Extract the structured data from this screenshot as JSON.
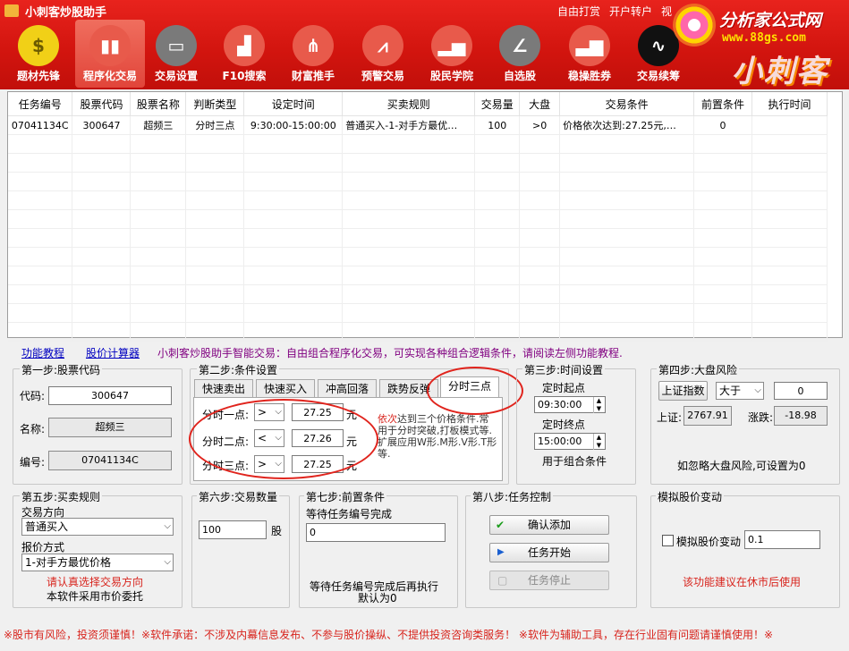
{
  "window": {
    "title": "小刺客炒股助手"
  },
  "toplinks": [
    "自由打赏",
    "开户转户",
    "视"
  ],
  "brand": {
    "logo_text": "分析家公式网",
    "url": "www.88gs.com",
    "watermark": "小刺客"
  },
  "nav": [
    {
      "label": "题材先锋",
      "icon": "coin-icon",
      "color": "#f1d017"
    },
    {
      "label": "程序化交易",
      "icon": "bar-chart-icon",
      "color": "#e85a4b"
    },
    {
      "label": "交易设置",
      "icon": "monitor-chart-icon",
      "color": "#7a7a7a"
    },
    {
      "label": "F10搜索",
      "icon": "growth-chart-icon",
      "color": "#e85a4b"
    },
    {
      "label": "财富推手",
      "icon": "network-icon",
      "color": "#e85a4b"
    },
    {
      "label": "预警交易",
      "icon": "trend-chart-icon",
      "color": "#e85a4b"
    },
    {
      "label": "股民学院",
      "icon": "bars-flag-icon",
      "color": "#e85a4b"
    },
    {
      "label": "自选股",
      "icon": "line-chart-icon",
      "color": "#7a7a7a"
    },
    {
      "label": "稳操胜券",
      "icon": "rising-bars-icon",
      "color": "#e85a4b"
    },
    {
      "label": "交易续筹",
      "icon": "wave-chart-icon",
      "color": "#111111"
    }
  ],
  "table": {
    "columns": [
      "任务编号",
      "股票代码",
      "股票名称",
      "判断类型",
      "设定时间",
      "买卖规则",
      "交易量",
      "大盘",
      "交易条件",
      "前置条件",
      "执行时间"
    ],
    "rows": [
      [
        "07041134C",
        "300647",
        "超频三",
        "分时三点",
        "9:30:00-15:00:00",
        "普通买入-1-对手方最优…",
        "100",
        ">0",
        "价格依次达到:27.25元,…",
        "0",
        ""
      ]
    ]
  },
  "infobar": {
    "tutorial_link": "功能教程",
    "calc_link": "股价计算器",
    "intro": "小刺客炒股助手智能交易：自由组合程序化交易，可实现各种组合逻辑条件，请阅读左侧功能教程."
  },
  "step1": {
    "title": "第一步:股票代码",
    "code_label": "代码:",
    "code": "300647",
    "name_label": "名称:",
    "name": "超频三",
    "id_label": "编号:",
    "id": "07041134C"
  },
  "step2": {
    "title": "第二步:条件设置",
    "tabs": [
      "快速卖出",
      "快速买入",
      "冲高回落",
      "跌势反弹",
      "分时三点"
    ],
    "points": [
      {
        "label": "分时一点:",
        "op": ">",
        "value": "27.25",
        "unit": "元"
      },
      {
        "label": "分时二点:",
        "op": "<",
        "value": "27.26",
        "unit": "元"
      },
      {
        "label": "分时三点:",
        "op": ">",
        "value": "27.25",
        "unit": "元"
      }
    ],
    "hint_prefix": "依次",
    "hint": "达到三个价格条件.常用于分时突破,打板模式等.扩展应用W形.M形.V形.T形等."
  },
  "step3": {
    "title": "第三步:时间设置",
    "start_label": "定时起点",
    "start": "09:30:00",
    "end_label": "定时终点",
    "end": "15:00:00",
    "note": "用于组合条件"
  },
  "step4": {
    "title": "第四步:大盘风险",
    "index_btn": "上证指数",
    "cmp": "大于",
    "threshold": "0",
    "sh_label": "上证:",
    "sh_value": "2767.91",
    "change_label": "涨跌:",
    "change_value": "-18.98",
    "note": "如忽略大盘风险,可设置为0"
  },
  "step5": {
    "title": "第五步:买卖规则",
    "dir_label": "交易方向",
    "dir": "普通买入",
    "price_label": "报价方式",
    "price": "1-对手方最优价格",
    "warn": "请认真选择交易方向",
    "note": "本软件采用市价委托"
  },
  "step6": {
    "title": "第六步:交易数量",
    "qty": "100",
    "unit": "股"
  },
  "step7": {
    "title": "第七步:前置条件",
    "label": "等待任务编号完成",
    "value": "0",
    "note1": "等待任务编号完成后再执行",
    "note2": "默认为0"
  },
  "step8": {
    "title": "第八步:任务控制",
    "confirm": "确认添加",
    "start": "任务开始",
    "stop": "任务停止"
  },
  "sim": {
    "title": "模拟股价变动",
    "check_label": "模拟股价变动",
    "value": "0.1",
    "note": "该功能建议在休市后使用"
  },
  "footer": {
    "text": "※股市有风险，投资须谨慎！※软件承诺：不涉及内幕信息发布、不参与股价操纵、不提供投资咨询类服务！ ※软件为辅助工具，存在行业固有问题请谨慎使用！※"
  }
}
